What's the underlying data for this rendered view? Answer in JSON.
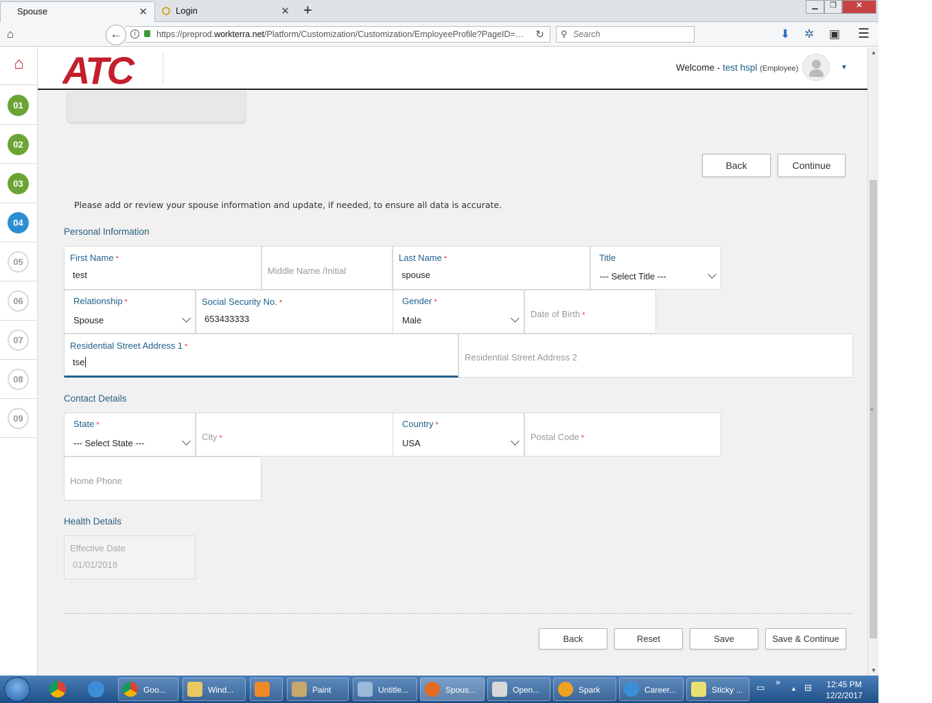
{
  "browser": {
    "tabs": [
      {
        "label": "Spouse",
        "active": true
      },
      {
        "label": "Login",
        "active": false
      }
    ],
    "url_prefix": "https://preprod.",
    "url_domain": "workterra.net",
    "url_path": "/Platform/Customization/Customization/EmployeeProfile?PageID=…",
    "search_placeholder": "Search"
  },
  "header": {
    "logo_text": "ATC",
    "welcome_label": "Welcome -",
    "user_name": "test hspl",
    "user_role": "(Employee)"
  },
  "steps": [
    {
      "label": "01",
      "state": "done"
    },
    {
      "label": "02",
      "state": "done"
    },
    {
      "label": "03",
      "state": "done"
    },
    {
      "label": "04",
      "state": "current"
    },
    {
      "label": "05",
      "state": "todo"
    },
    {
      "label": "06",
      "state": "todo"
    },
    {
      "label": "07",
      "state": "todo"
    },
    {
      "label": "08",
      "state": "todo"
    },
    {
      "label": "09",
      "state": "todo"
    }
  ],
  "top_buttons": {
    "back": "Back",
    "continue": "Continue"
  },
  "intro_text": "Please add or review your spouse information and update, if needed, to ensure all data is accurate.",
  "sections": {
    "personal": "Personal Information",
    "contact": "Contact Details",
    "health": "Health Details"
  },
  "fields": {
    "first_name": {
      "label": "First Name",
      "value": "test"
    },
    "middle_name": {
      "placeholder": "Middle Name /Initial"
    },
    "last_name": {
      "label": "Last Name",
      "value": "spouse"
    },
    "title": {
      "label": "Title",
      "value": "--- Select Title ---"
    },
    "relationship": {
      "label": "Relationship",
      "value": "Spouse"
    },
    "ssn": {
      "label": "Social Security No.",
      "value": "653433333"
    },
    "gender": {
      "label": "Gender",
      "value": "Male"
    },
    "dob": {
      "placeholder": "Date of Birth"
    },
    "address1": {
      "label": "Residential Street Address 1",
      "value": "tse"
    },
    "address2": {
      "placeholder": "Residential Street Address 2"
    },
    "state": {
      "label": "State",
      "value": "--- Select State ---"
    },
    "city": {
      "placeholder": "City"
    },
    "country": {
      "label": "Country",
      "value": "USA"
    },
    "postal": {
      "placeholder": "Postal Code"
    },
    "home_phone": {
      "placeholder": "Home Phone"
    },
    "effective_date": {
      "label": "Effective Date",
      "value": "01/01/2018"
    }
  },
  "bottom_buttons": {
    "back": "Back",
    "reset": "Reset",
    "save": "Save",
    "save_continue": "Save & Continue"
  },
  "taskbar": {
    "items": [
      {
        "label": "Goo..."
      },
      {
        "label": "Wind..."
      },
      {
        "label": ""
      },
      {
        "label": "Paint"
      },
      {
        "label": "Untitle..."
      },
      {
        "label": "Spous..."
      },
      {
        "label": "Open..."
      },
      {
        "label": "Spark"
      },
      {
        "label": "Career..."
      },
      {
        "label": "Sticky ..."
      }
    ],
    "time": "12:45 PM",
    "date": "12/2/2017"
  },
  "colors": {
    "brand_red": "#c41e2b",
    "label_blue": "#1f5f8b",
    "step_done": "#6aa437",
    "step_current": "#2d8fd2",
    "required": "#dd3333"
  }
}
